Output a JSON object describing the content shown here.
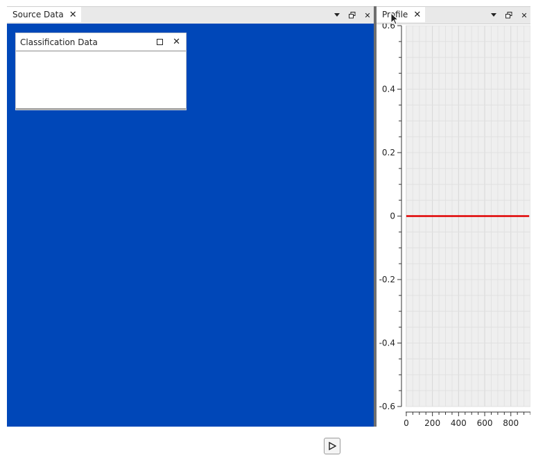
{
  "left_panel": {
    "tab_label": "Source Data",
    "floating_window": {
      "title": "Classification Data"
    }
  },
  "right_panel": {
    "tab_label": "Profile"
  },
  "icons": {
    "tab_close": "close-icon",
    "menu": "dropdown-triangle-icon",
    "float": "restore-window-icon",
    "maximize": "maximize-icon",
    "play": "play-icon"
  },
  "colors": {
    "canvas_blue": "#0047b8",
    "profile_line": "#e00000",
    "plot_bg": "#efefef"
  },
  "chart_data": {
    "type": "line",
    "title": "",
    "xlabel": "",
    "ylabel": "",
    "xlim": [
      -5,
      950
    ],
    "ylim": [
      -0.6,
      0.6
    ],
    "x_ticks": [
      "0",
      "200",
      "400",
      "600",
      "800"
    ],
    "x_tick_values": [
      0,
      200,
      400,
      600,
      800
    ],
    "y_ticks": [
      "0.6",
      "0.4",
      "0.2",
      "0",
      "-0.2",
      "-0.4",
      "-0.6"
    ],
    "y_tick_values": [
      0.6,
      0.4,
      0.2,
      0,
      -0.2,
      -0.4,
      -0.6
    ],
    "grid": true,
    "series": [
      {
        "x": [
          0,
          940
        ],
        "values": [
          0,
          0
        ]
      }
    ]
  }
}
